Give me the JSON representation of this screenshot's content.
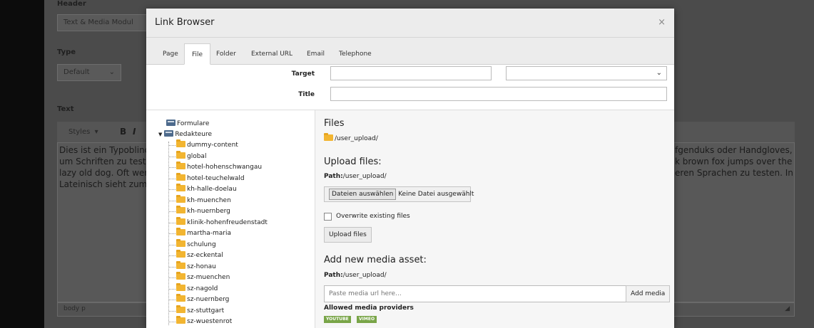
{
  "background": {
    "header_label": "Header",
    "header_value": "Text & Media Modul",
    "type_label": "Type",
    "type_value": "Default",
    "text_label": "Text",
    "styles_label": "Styles",
    "bold_label": "B",
    "italic_label": "I",
    "text_lines_left": [
      "Dies ist ein Typoblindt",
      "um Schriften zu tester",
      "lazy old dog. Oft werd",
      "Lateinisch sieht zum B"
    ],
    "text_lines_right": [
      "fgenduks oder Handgloves,",
      "k brown fox jumps over the",
      "eren Sprachen zu testen. In"
    ],
    "status_path": "body  p"
  },
  "modal": {
    "title": "Link Browser",
    "close_label": "×",
    "tabs": [
      {
        "label": "Page"
      },
      {
        "label": "File",
        "active": true
      },
      {
        "label": "Folder"
      },
      {
        "label": "External URL"
      },
      {
        "label": "Email"
      },
      {
        "label": "Telephone"
      }
    ],
    "target_label": "Target",
    "target_value": "",
    "target_select_value": "",
    "title_label": "Title",
    "title_value": ""
  },
  "tree": {
    "mounts": [
      "Formulare",
      "Redakteure"
    ],
    "folders": [
      "dummy-content",
      "global",
      "hotel-hohenschwangau",
      "hotel-teuchelwald",
      "kh-halle-doelau",
      "kh-muenchen",
      "kh-nuernberg",
      "klinik-hohenfreudenstadt",
      "martha-maria",
      "schulung",
      "sz-eckental",
      "sz-honau",
      "sz-muenchen",
      "sz-nagold",
      "sz-nuernberg",
      "sz-stuttgart",
      "sz-wuestenrot"
    ]
  },
  "content": {
    "files_heading": "Files",
    "current_folder": "/user_upload/",
    "upload_heading": "Upload files:",
    "path_label": "Path:",
    "path_value": "/user_upload/",
    "choose_files_label": "Dateien auswählen",
    "no_file_label": "Keine Datei ausgewählt",
    "overwrite_label": "Overwrite existing files",
    "upload_button_label": "Upload files",
    "media_heading": "Add new media asset:",
    "media_placeholder": "Paste media url here...",
    "add_media_label": "Add media",
    "providers_label": "Allowed media providers",
    "providers": [
      "YOUTUBE",
      "VIMEO"
    ]
  },
  "colors": {
    "accent_green": "#79a548",
    "folder_yellow": "#f2b531",
    "mount_blue": "#4d6a8c"
  }
}
